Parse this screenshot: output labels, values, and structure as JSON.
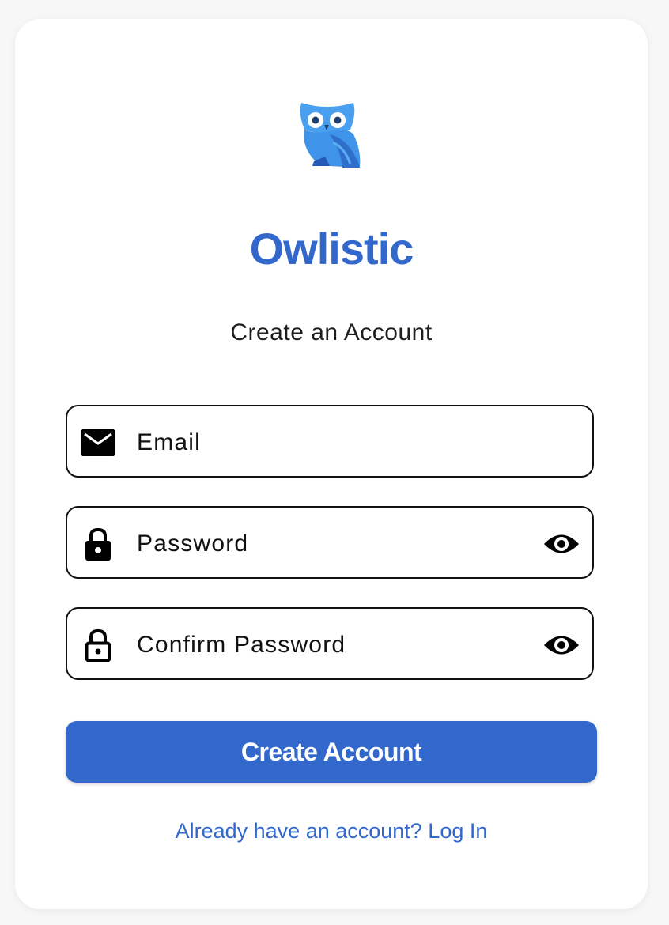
{
  "app": {
    "title": "Owlistic",
    "logo_icon": "owl-logo-icon"
  },
  "form": {
    "heading": "Create an Account",
    "fields": {
      "email": {
        "placeholder": "Email",
        "value": "",
        "icon": "mail-icon"
      },
      "password": {
        "placeholder": "Password",
        "value": "",
        "icon": "lock-icon",
        "toggle_icon": "eye-icon"
      },
      "confirm_password": {
        "placeholder": "Confirm Password",
        "value": "",
        "icon": "lock-outline-icon",
        "toggle_icon": "eye-icon"
      }
    },
    "submit_label": "Create Account",
    "login_link": "Already have an account? Log In"
  },
  "colors": {
    "brand": "#3268cc",
    "text": "#1e1e1e",
    "background": "#ffffff",
    "page": "#f7f7f8"
  }
}
